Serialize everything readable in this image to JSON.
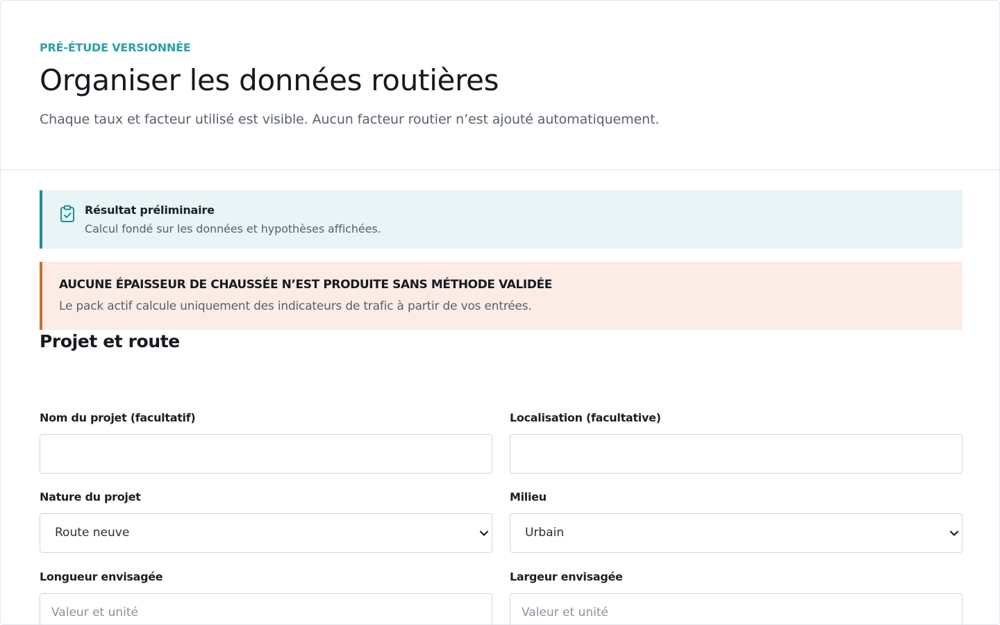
{
  "header": {
    "eyebrow": "PRÉ-ÉTUDE VERSIONNÉE",
    "title": "Organiser les données routières",
    "subtitle": "Chaque taux et facteur utilisé est visible. Aucun facteur routier n’est ajouté automatiquement."
  },
  "notices": {
    "info": {
      "icon": "clipboard-check-icon",
      "title": "Résultat préliminaire",
      "text": "Calcul fondé sur les données et hypothèses affichées.",
      "accent": "#1c8e97",
      "background": "#e8f4f5"
    },
    "warning": {
      "title": "AUCUNE ÉPAISSEUR DE CHAUSSÉE N’EST PRODUITE SANS MÉTHODE VALIDÉE",
      "text": "Le pack actif calcule uniquement des indicateurs de trafic à partir de vos entrées.",
      "accent": "#c8702e",
      "background": "#fbece6"
    }
  },
  "section": {
    "title": "Projet et route"
  },
  "form": {
    "project_name": {
      "label": "Nom du projet (facultatif)",
      "value": ""
    },
    "location": {
      "label": "Localisation (facultative)",
      "value": ""
    },
    "project_nature": {
      "label": "Nature du projet",
      "selected": "Route neuve"
    },
    "environment": {
      "label": "Milieu",
      "selected": "Urbain"
    },
    "length": {
      "label": "Longueur envisagée",
      "placeholder": "Valeur et unité"
    },
    "width": {
      "label": "Largeur envisagée",
      "placeholder": "Valeur et unité"
    }
  },
  "colors": {
    "eyebrow": "#2aa0a7",
    "text_muted": "#59616b",
    "border": "#cfd5db"
  }
}
